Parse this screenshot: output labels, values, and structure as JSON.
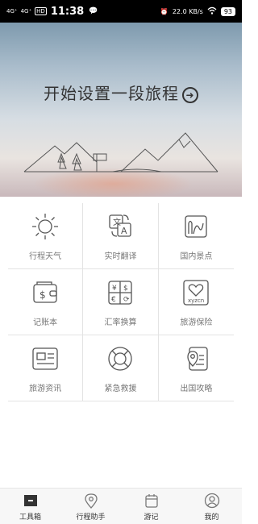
{
  "status_bar": {
    "signal1": "4G⁺",
    "signal2": "4G⁺",
    "hd": "HD",
    "time": "11:38",
    "speed": "22.0",
    "speed_unit": "KB/s",
    "battery": "93"
  },
  "hero": {
    "title": "开始设置一段旅程",
    "arrow_icon": "arrow-right-circle-icon"
  },
  "tools": [
    {
      "label": "行程天气",
      "icon": "sun-icon"
    },
    {
      "label": "实时翻译",
      "icon": "translate-icon"
    },
    {
      "label": "国内景点",
      "icon": "map-landscape-icon"
    },
    {
      "label": "记账本",
      "icon": "wallet-icon"
    },
    {
      "label": "汇率换算",
      "icon": "currency-exchange-icon"
    },
    {
      "label": "旅游保险",
      "icon": "insurance-heart-icon",
      "icon_text": "xyzcn"
    },
    {
      "label": "旅游资讯",
      "icon": "news-icon"
    },
    {
      "label": "紧急救援",
      "icon": "lifebuoy-icon"
    },
    {
      "label": "出国攻略",
      "icon": "travel-guide-icon"
    }
  ],
  "tabbar": {
    "items": [
      {
        "label": "工具箱",
        "icon": "toolbox-icon"
      },
      {
        "label": "行程助手",
        "icon": "location-pin-icon"
      },
      {
        "label": "游记",
        "icon": "notebook-icon"
      },
      {
        "label": "我的",
        "icon": "user-icon"
      }
    ]
  }
}
